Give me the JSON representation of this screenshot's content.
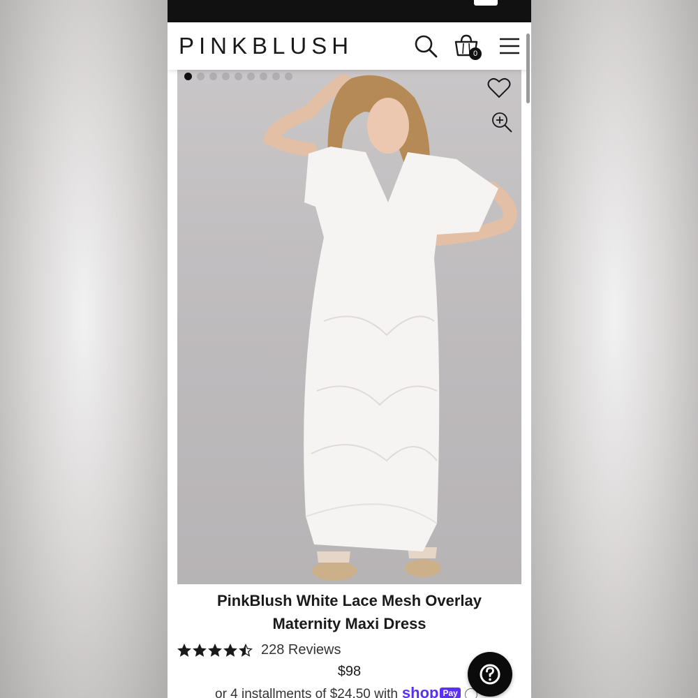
{
  "status_bar": {
    "left_text": "",
    "right_text": ""
  },
  "header": {
    "logo": "PINKBLUSH",
    "cart_count": "0"
  },
  "gallery": {
    "image_count": 9,
    "active_index": 0
  },
  "product": {
    "title": "PinkBlush White Lace Mesh Overlay Maternity Maxi Dress",
    "rating": 4.5,
    "max_rating": 5,
    "reviews_label": "228 Reviews",
    "price": "$98",
    "installments_text": "or 4 installments of $24.50 with",
    "shop_label": "shop",
    "pay_label": "Pay"
  },
  "colors": {
    "header_bg": "#ffffff",
    "status_bar_bg": "#111111",
    "shop_pay_purple": "#5a31f4",
    "help_button_bg": "#0b0b0b"
  },
  "icons": [
    "search-icon",
    "shopping-bag-icon",
    "menu-icon",
    "heart-icon",
    "zoom-in-icon",
    "star-icon",
    "help-icon",
    "info-icon"
  ]
}
